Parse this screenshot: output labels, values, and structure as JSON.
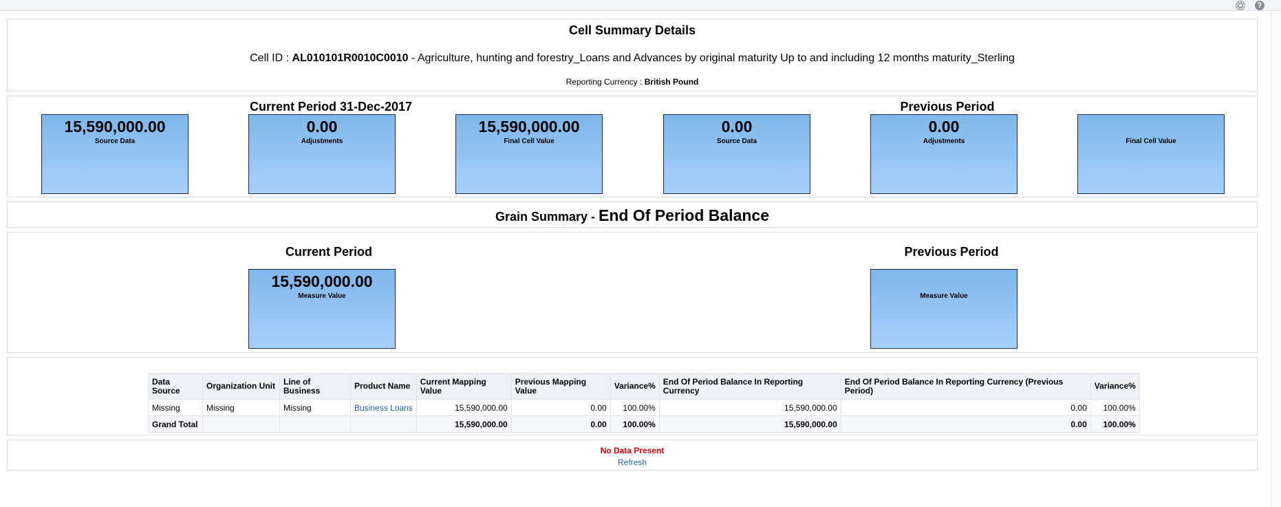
{
  "header": {
    "title": "Cell Summary Details",
    "cell_id_label": "Cell ID : ",
    "cell_id": "AL010101R0010C0010",
    "cell_desc": " - Agriculture, hunting and forestry_Loans and Advances by original maturity Up to and including 12 months maturity_Sterling",
    "currency_label": "Reporting Currency : ",
    "currency_value": "British Pound"
  },
  "topbar": {
    "settings_icon": "gear-icon",
    "help_icon": "question-icon",
    "help_glyph": "?"
  },
  "summary": {
    "current_title": "Current Period 31-Dec-2017",
    "previous_title": "Previous Period",
    "tiles": [
      {
        "value": "15,590,000.00",
        "label": "Source Data"
      },
      {
        "value": "0.00",
        "label": "Adjustments"
      },
      {
        "value": "15,590,000.00",
        "label": "Final Cell Value"
      },
      {
        "value": "0.00",
        "label": "Source Data"
      },
      {
        "value": "0.00",
        "label": "Adjustments"
      },
      {
        "value": "",
        "label": "Final Cell Value"
      }
    ]
  },
  "grain": {
    "prefix": "Grain Summary - ",
    "measure": "End Of Period Balance"
  },
  "measure": {
    "current_title": "Current Period",
    "previous_title": "Previous Period",
    "current_value": "15,590,000.00",
    "current_label": "Measure Value",
    "previous_value": "",
    "previous_label": "Measure Value"
  },
  "table": {
    "headers": [
      "Data Source",
      "Organization Unit",
      "Line of Business",
      "Product Name",
      "Current Mapping Value",
      "Previous Mapping Value",
      "Variance%",
      "End Of Period Balance In Reporting Currency",
      "End Of Period Balance In Reporting Currency (Previous Period)",
      "Variance%"
    ],
    "rows": [
      [
        "Missing",
        "Missing",
        "Missing",
        "Business Loans",
        "15,590,000.00",
        "0.00",
        "100.00%",
        "15,590,000.00",
        "0.00",
        "100.00%"
      ]
    ],
    "total": [
      "Grand Total",
      "",
      "",
      "",
      "15,590,000.00",
      "0.00",
      "100.00%",
      "15,590,000.00",
      "0.00",
      "100.00%"
    ]
  },
  "footer": {
    "message": "No Data Present",
    "refresh": "Refresh",
    "message_color": "#cc0000",
    "link_color": "#1f5fa8"
  }
}
